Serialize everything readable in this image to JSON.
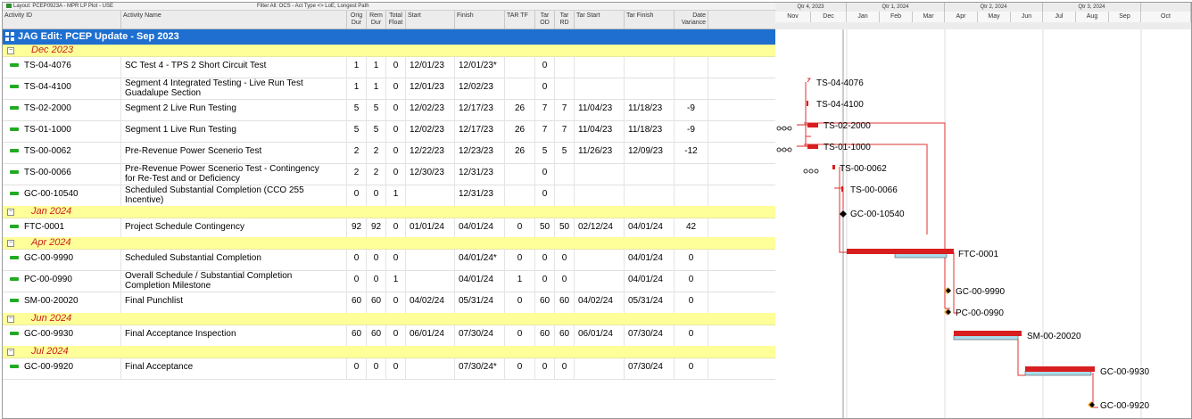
{
  "toolbar": {
    "layout_label": "Layout: PCEP0923A - MPR LP Plot - USE",
    "filter_label": "Filter All: OCS - Act Type <> LoE, Longest Path"
  },
  "columns": {
    "activity_id": "Activity ID",
    "activity_name": "Activity Name",
    "orig_dur": "Orig Dur",
    "rem_dur": "Rem Dur",
    "total_float": "Total Float",
    "start": "Start",
    "finish": "Finish",
    "tar_tf": "TAR TF",
    "tar_od": "Tar OD",
    "tar_rd": "Tar RD",
    "tar_start": "Tar Start",
    "tar_finish": "Tar Finish",
    "date_variance": "Date Variance"
  },
  "project": {
    "title": "JAG Edit: PCEP Update - Sep 2023"
  },
  "wbs": [
    {
      "label": "Dec 2023"
    },
    {
      "label": "Jan 2024"
    },
    {
      "label": "Apr 2024"
    },
    {
      "label": "Jun 2024"
    },
    {
      "label": "Jul 2024"
    }
  ],
  "activities": [
    {
      "id": "TS-04-4076",
      "name": "SC Test 4 - TPS 2 Short Circuit Test",
      "od": "1",
      "rd": "1",
      "tf": "0",
      "start": "12/01/23",
      "finish": "12/01/23*",
      "tartf": "",
      "tarod": "0",
      "tarrd": "",
      "tarstart": "",
      "tarfinish": "",
      "var": ""
    },
    {
      "id": "TS-04-4100",
      "name": "Segment 4 Integrated Testing - Live Run Test Guadalupe Section",
      "od": "1",
      "rd": "1",
      "tf": "0",
      "start": "12/01/23",
      "finish": "12/02/23",
      "tartf": "",
      "tarod": "0",
      "tarrd": "",
      "tarstart": "",
      "tarfinish": "",
      "var": ""
    },
    {
      "id": "TS-02-2000",
      "name": "Segment 2 Live Run Testing",
      "od": "5",
      "rd": "5",
      "tf": "0",
      "start": "12/02/23",
      "finish": "12/17/23",
      "tartf": "26",
      "tarod": "7",
      "tarrd": "7",
      "tarstart": "11/04/23",
      "tarfinish": "11/18/23",
      "var": "-9"
    },
    {
      "id": "TS-01-1000",
      "name": "Segment 1 Live Run Testing",
      "od": "5",
      "rd": "5",
      "tf": "0",
      "start": "12/02/23",
      "finish": "12/17/23",
      "tartf": "26",
      "tarod": "7",
      "tarrd": "7",
      "tarstart": "11/04/23",
      "tarfinish": "11/18/23",
      "var": "-9"
    },
    {
      "id": "TS-00-0062",
      "name": "Pre-Revenue Power Scenerio Test",
      "od": "2",
      "rd": "2",
      "tf": "0",
      "start": "12/22/23",
      "finish": "12/23/23",
      "tartf": "26",
      "tarod": "5",
      "tarrd": "5",
      "tarstart": "11/26/23",
      "tarfinish": "12/09/23",
      "var": "-12"
    },
    {
      "id": "TS-00-0066",
      "name": "Pre-Revenue Power Scenerio Test - Contingency for Re-Test and or Deficiency",
      "od": "2",
      "rd": "2",
      "tf": "0",
      "start": "12/30/23",
      "finish": "12/31/23",
      "tartf": "",
      "tarod": "0",
      "tarrd": "",
      "tarstart": "",
      "tarfinish": "",
      "var": ""
    },
    {
      "id": "GC-00-10540",
      "name": "Scheduled Substantial Completion (CCO 255 Incentive)",
      "od": "0",
      "rd": "0",
      "tf": "1",
      "start": "",
      "finish": "12/31/23",
      "tartf": "",
      "tarod": "0",
      "tarrd": "",
      "tarstart": "",
      "tarfinish": "",
      "var": ""
    },
    {
      "id": "FTC-0001",
      "name": "Project Schedule Contingency",
      "od": "92",
      "rd": "92",
      "tf": "0",
      "start": "01/01/24",
      "finish": "04/01/24",
      "tartf": "0",
      "tarod": "50",
      "tarrd": "50",
      "tarstart": "02/12/24",
      "tarfinish": "04/01/24",
      "var": "42"
    },
    {
      "id": "GC-00-9990",
      "name": "Scheduled Substantial Completion",
      "od": "0",
      "rd": "0",
      "tf": "0",
      "start": "",
      "finish": "04/01/24*",
      "tartf": "0",
      "tarod": "0",
      "tarrd": "0",
      "tarstart": "",
      "tarfinish": "04/01/24",
      "var": "0"
    },
    {
      "id": "PC-00-0990",
      "name": "Overall Schedule / Substantial Completion Completion Milestone",
      "od": "0",
      "rd": "0",
      "tf": "1",
      "start": "",
      "finish": "04/01/24",
      "tartf": "1",
      "tarod": "0",
      "tarrd": "0",
      "tarstart": "",
      "tarfinish": "04/01/24",
      "var": "0"
    },
    {
      "id": "SM-00-20020",
      "name": "Final Punchlist",
      "od": "60",
      "rd": "60",
      "tf": "0",
      "start": "04/02/24",
      "finish": "05/31/24",
      "tartf": "0",
      "tarod": "60",
      "tarrd": "60",
      "tarstart": "04/02/24",
      "tarfinish": "05/31/24",
      "var": "0"
    },
    {
      "id": "GC-00-9930",
      "name": "Final Acceptance Inspection",
      "od": "60",
      "rd": "60",
      "tf": "0",
      "start": "06/01/24",
      "finish": "07/30/24",
      "tartf": "0",
      "tarod": "60",
      "tarrd": "60",
      "tarstart": "06/01/24",
      "tarfinish": "07/30/24",
      "var": "0"
    },
    {
      "id": "GC-00-9920",
      "name": "Final Acceptance",
      "od": "0",
      "rd": "0",
      "tf": "0",
      "start": "",
      "finish": "07/30/24*",
      "tartf": "0",
      "tarod": "0",
      "tarrd": "0",
      "tarstart": "",
      "tarfinish": "07/30/24",
      "var": "0"
    }
  ],
  "timescale": {
    "quarters": [
      "Qtr 4, 2023",
      "Qtr 1, 2024",
      "Qtr 2, 2024",
      "Qtr 3, 2024"
    ],
    "months": [
      "Nov",
      "Dec",
      "Jan",
      "Feb",
      "Mar",
      "Apr",
      "May",
      "Jun",
      "Jul",
      "Aug",
      "Sep",
      "Oct"
    ]
  },
  "gantt_labels": [
    "TS-04-4076",
    "TS-04-4100",
    "TS-02-2000",
    "TS-01-1000",
    "TS-00-0062",
    "TS-00-0066",
    "GC-00-10540",
    "FTC-0001",
    "GC-00-9990",
    "PC-00-0990",
    "SM-00-20020",
    "GC-00-9930",
    "GC-00-9920"
  ],
  "colors": {
    "project_band": "#1e6fd0",
    "wbs_band": "#ffff99",
    "wbs_text": "#c82020",
    "activity_icon": "#22aa22",
    "critical_bar": "#d81e1e",
    "target_bar": "#a8dcea",
    "logic_line": "#e03030",
    "milestone": "#000000",
    "milestone_target": "#f5a623"
  }
}
